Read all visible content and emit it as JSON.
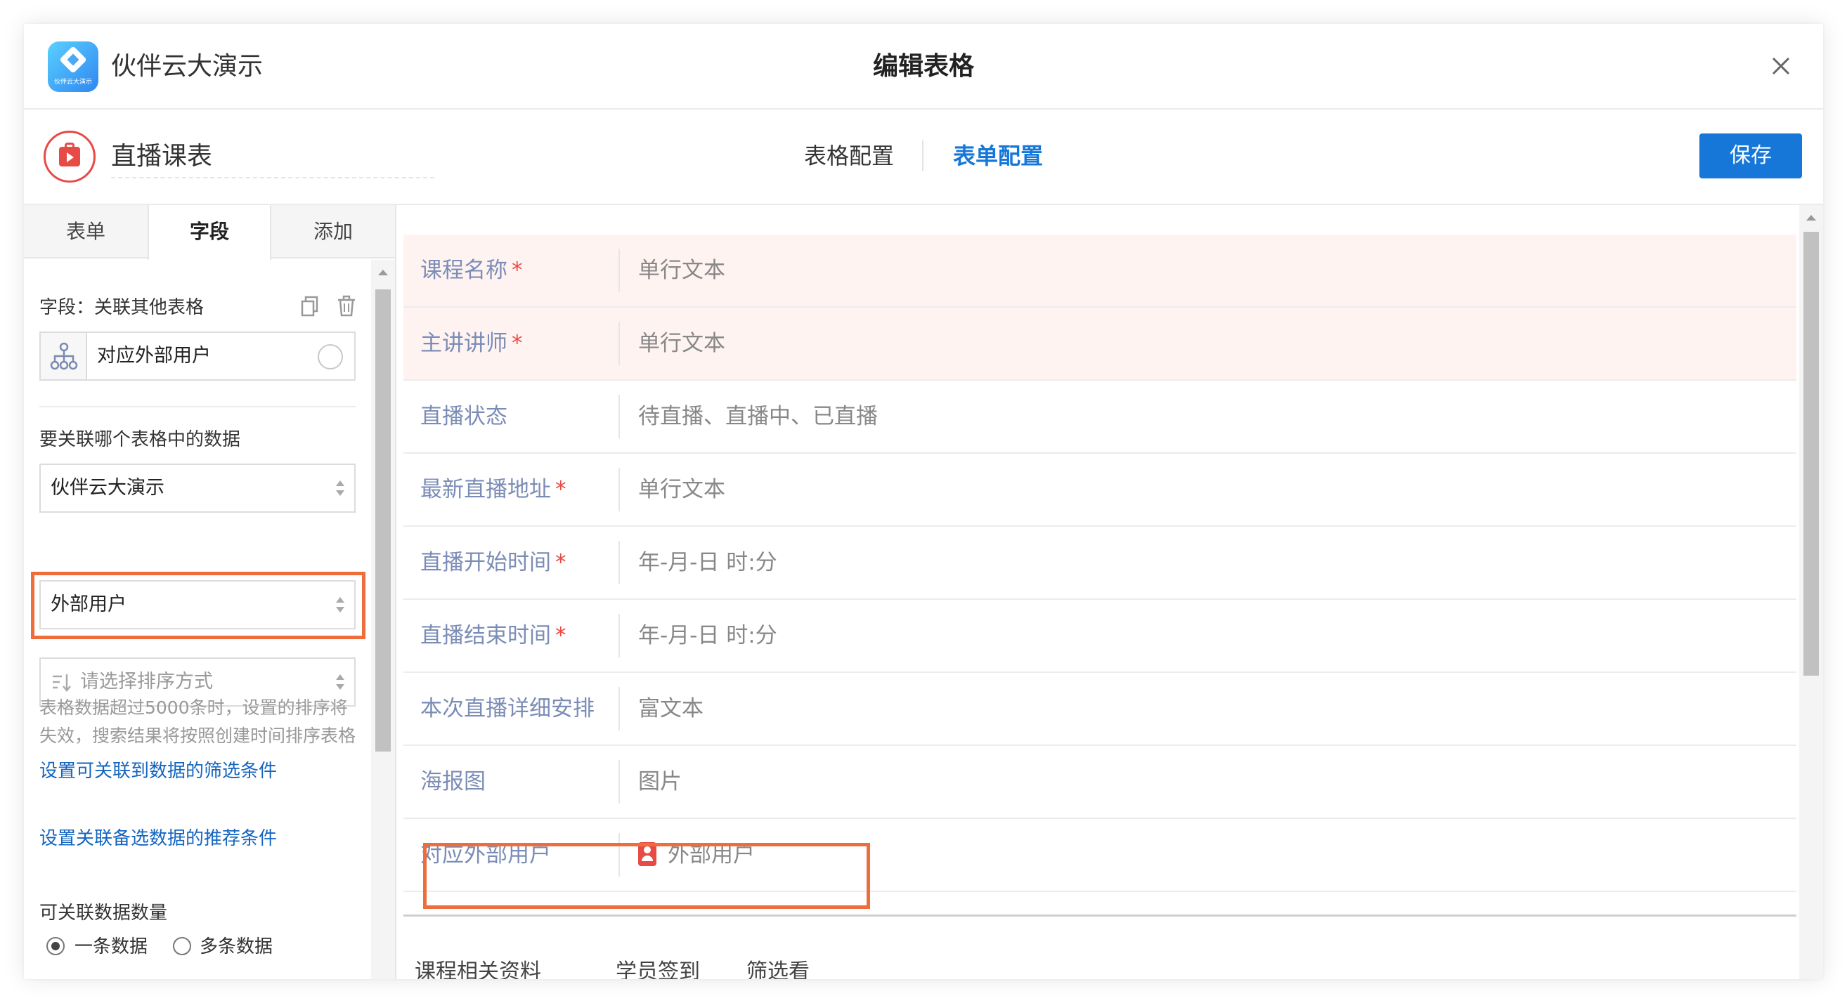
{
  "app": {
    "name": "伙伴云大演示",
    "logo_text": "伙伴云大演示"
  },
  "dialog": {
    "title": "编辑表格"
  },
  "header": {
    "form_name": "直播课表",
    "tabs": [
      {
        "label": "表格配置",
        "active": false
      },
      {
        "label": "表单配置",
        "active": true
      }
    ],
    "save_label": "保存"
  },
  "left_panel": {
    "tabs": [
      {
        "label": "表单",
        "active": false
      },
      {
        "label": "字段",
        "active": true
      },
      {
        "label": "添加",
        "active": false
      }
    ],
    "field_label": "字段：关联其他表格",
    "field_name": "对应外部用户",
    "link_label": "要关联哪个表格中的数据",
    "workspace_select": "伙伴云大演示",
    "table_select": "外部用户",
    "sort_placeholder": "请选择排序方式",
    "hint": "表格数据超过5000条时，设置的排序将失效，搜索结果将按照创建时间排序表格",
    "filter_link": "设置可关联到数据的筛选条件",
    "recommend_link": "设置关联备选数据的推荐条件",
    "count_label": "可关联数据数量",
    "count_options": [
      {
        "label": "一条数据",
        "selected": true
      },
      {
        "label": "多条数据",
        "selected": false
      }
    ]
  },
  "form_fields": [
    {
      "label": "课程名称",
      "required": true,
      "value": "单行文本",
      "highlight": true
    },
    {
      "label": "主讲讲师",
      "required": true,
      "value": "单行文本",
      "highlight": true
    },
    {
      "label": "直播状态",
      "required": false,
      "value": "待直播、直播中、已直播",
      "highlight": false
    },
    {
      "label": "最新直播地址",
      "required": true,
      "value": "单行文本",
      "highlight": false
    },
    {
      "label": "直播开始时间",
      "required": true,
      "value": "年-月-日 时:分",
      "highlight": false
    },
    {
      "label": "直播结束时间",
      "required": true,
      "value": "年-月-日 时:分",
      "highlight": false
    },
    {
      "label": "本次直播详细安排",
      "required": false,
      "value": "富文本",
      "highlight": false
    },
    {
      "label": "海报图",
      "required": false,
      "value": "图片",
      "highlight": false
    },
    {
      "label": "对应外部用户",
      "required": false,
      "value": "外部用户",
      "highlight": false,
      "icon": "user-card-icon"
    }
  ],
  "bottom_tabs": [
    "课程相关资料",
    "学员签到",
    "筛选看"
  ],
  "colors": {
    "accent": "#1677d9",
    "required": "#e84a46",
    "highlight_box": "#ee6d3a",
    "label": "#7b8db6"
  }
}
